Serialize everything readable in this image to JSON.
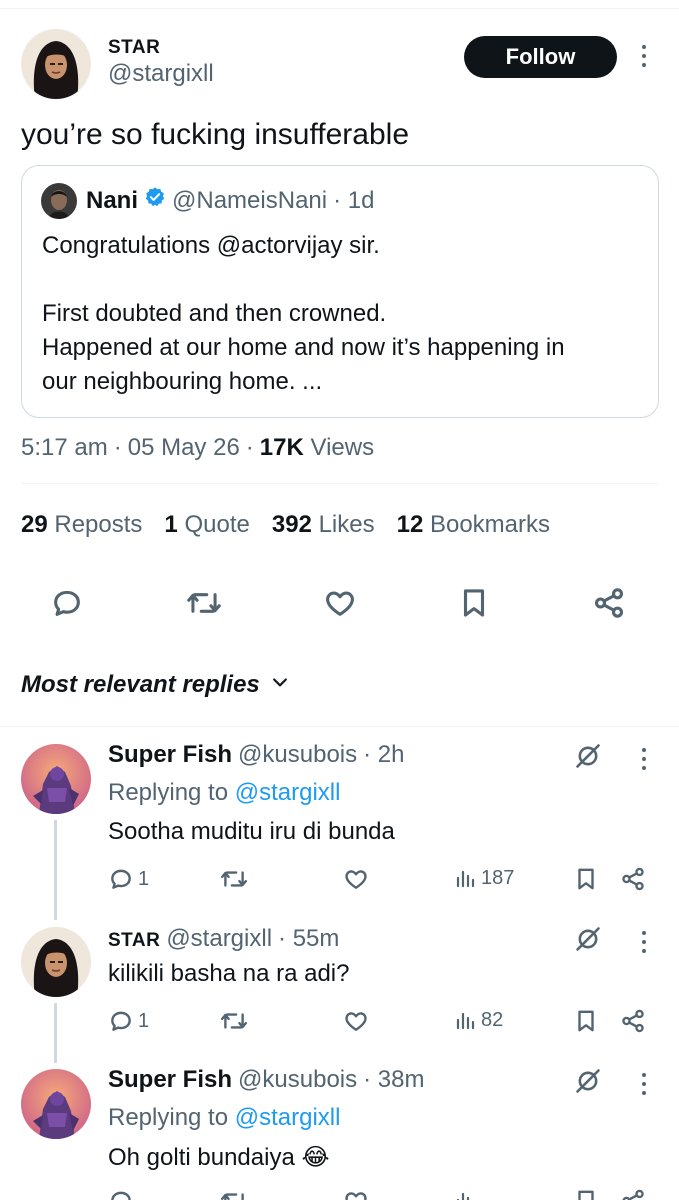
{
  "tweet": {
    "author_name": "STAR",
    "author_handle": "@stargixll",
    "follow_label": "Follow",
    "text": "you’re so fucking insufferable",
    "quote": {
      "author_name": "Nani",
      "author_handle": "@NameisNani",
      "time": "· 1d",
      "line1": "Congratulations @actorvijay sir.",
      "line2": "First doubted and then crowned.",
      "line3": "Happened at our home and now it’s happening in",
      "line4": "our neighbouring home. ..."
    },
    "time": "5:17 am",
    "date": "05 May 26",
    "views_count": "17K",
    "views_label": "Views",
    "stats": {
      "reposts_count": "29",
      "reposts_label": "Reposts",
      "quotes_count": "1",
      "quotes_label": "Quote",
      "likes_count": "392",
      "likes_label": "Likes",
      "bookmarks_count": "12",
      "bookmarks_label": "Bookmarks"
    }
  },
  "replies_sort_label": "Most relevant replies",
  "replies": [
    {
      "author_name": "Super Fish",
      "author_handle": "@kusubois",
      "time": "· 2h",
      "replying_prefix": "Replying to",
      "replying_handle": "@stargixll",
      "text": "Sootha muditu iru di bunda",
      "reply_count": "1",
      "views": "187"
    },
    {
      "author_name": "STAR",
      "author_handle": "@stargixll",
      "time": "· 55m",
      "text": "kilikili basha na ra adi?",
      "reply_count": "1",
      "views": "82"
    },
    {
      "author_name": "Super Fish",
      "author_handle": "@kusubois",
      "time": "· 38m",
      "replying_prefix": "Replying to",
      "replying_handle": "@stargixll",
      "text": "Oh golti bundaiya 😂"
    }
  ],
  "icons": [
    "reply-icon",
    "repost-icon",
    "like-icon",
    "bookmark-icon",
    "share-icon",
    "views-icon",
    "grok-icon",
    "more-icon",
    "verified-badge-icon",
    "chevron-down-icon"
  ],
  "colors": {
    "accent": "#1d9bf0",
    "text": "#0f1419",
    "muted": "#536471",
    "button": "#0f1419",
    "border": "#cfd9de"
  }
}
